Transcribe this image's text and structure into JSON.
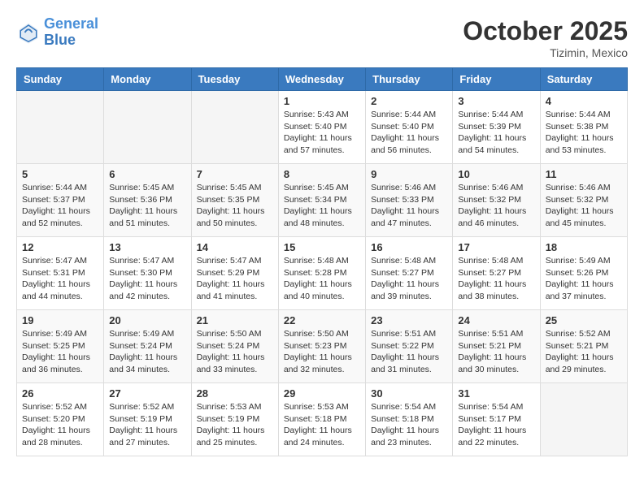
{
  "header": {
    "logo_line1": "General",
    "logo_line2": "Blue",
    "month": "October 2025",
    "location": "Tizimin, Mexico"
  },
  "weekdays": [
    "Sunday",
    "Monday",
    "Tuesday",
    "Wednesday",
    "Thursday",
    "Friday",
    "Saturday"
  ],
  "weeks": [
    [
      {
        "day": "",
        "info": ""
      },
      {
        "day": "",
        "info": ""
      },
      {
        "day": "",
        "info": ""
      },
      {
        "day": "1",
        "info": "Sunrise: 5:43 AM\nSunset: 5:40 PM\nDaylight: 11 hours\nand 57 minutes."
      },
      {
        "day": "2",
        "info": "Sunrise: 5:44 AM\nSunset: 5:40 PM\nDaylight: 11 hours\nand 56 minutes."
      },
      {
        "day": "3",
        "info": "Sunrise: 5:44 AM\nSunset: 5:39 PM\nDaylight: 11 hours\nand 54 minutes."
      },
      {
        "day": "4",
        "info": "Sunrise: 5:44 AM\nSunset: 5:38 PM\nDaylight: 11 hours\nand 53 minutes."
      }
    ],
    [
      {
        "day": "5",
        "info": "Sunrise: 5:44 AM\nSunset: 5:37 PM\nDaylight: 11 hours\nand 52 minutes."
      },
      {
        "day": "6",
        "info": "Sunrise: 5:45 AM\nSunset: 5:36 PM\nDaylight: 11 hours\nand 51 minutes."
      },
      {
        "day": "7",
        "info": "Sunrise: 5:45 AM\nSunset: 5:35 PM\nDaylight: 11 hours\nand 50 minutes."
      },
      {
        "day": "8",
        "info": "Sunrise: 5:45 AM\nSunset: 5:34 PM\nDaylight: 11 hours\nand 48 minutes."
      },
      {
        "day": "9",
        "info": "Sunrise: 5:46 AM\nSunset: 5:33 PM\nDaylight: 11 hours\nand 47 minutes."
      },
      {
        "day": "10",
        "info": "Sunrise: 5:46 AM\nSunset: 5:32 PM\nDaylight: 11 hours\nand 46 minutes."
      },
      {
        "day": "11",
        "info": "Sunrise: 5:46 AM\nSunset: 5:32 PM\nDaylight: 11 hours\nand 45 minutes."
      }
    ],
    [
      {
        "day": "12",
        "info": "Sunrise: 5:47 AM\nSunset: 5:31 PM\nDaylight: 11 hours\nand 44 minutes."
      },
      {
        "day": "13",
        "info": "Sunrise: 5:47 AM\nSunset: 5:30 PM\nDaylight: 11 hours\nand 42 minutes."
      },
      {
        "day": "14",
        "info": "Sunrise: 5:47 AM\nSunset: 5:29 PM\nDaylight: 11 hours\nand 41 minutes."
      },
      {
        "day": "15",
        "info": "Sunrise: 5:48 AM\nSunset: 5:28 PM\nDaylight: 11 hours\nand 40 minutes."
      },
      {
        "day": "16",
        "info": "Sunrise: 5:48 AM\nSunset: 5:27 PM\nDaylight: 11 hours\nand 39 minutes."
      },
      {
        "day": "17",
        "info": "Sunrise: 5:48 AM\nSunset: 5:27 PM\nDaylight: 11 hours\nand 38 minutes."
      },
      {
        "day": "18",
        "info": "Sunrise: 5:49 AM\nSunset: 5:26 PM\nDaylight: 11 hours\nand 37 minutes."
      }
    ],
    [
      {
        "day": "19",
        "info": "Sunrise: 5:49 AM\nSunset: 5:25 PM\nDaylight: 11 hours\nand 36 minutes."
      },
      {
        "day": "20",
        "info": "Sunrise: 5:49 AM\nSunset: 5:24 PM\nDaylight: 11 hours\nand 34 minutes."
      },
      {
        "day": "21",
        "info": "Sunrise: 5:50 AM\nSunset: 5:24 PM\nDaylight: 11 hours\nand 33 minutes."
      },
      {
        "day": "22",
        "info": "Sunrise: 5:50 AM\nSunset: 5:23 PM\nDaylight: 11 hours\nand 32 minutes."
      },
      {
        "day": "23",
        "info": "Sunrise: 5:51 AM\nSunset: 5:22 PM\nDaylight: 11 hours\nand 31 minutes."
      },
      {
        "day": "24",
        "info": "Sunrise: 5:51 AM\nSunset: 5:21 PM\nDaylight: 11 hours\nand 30 minutes."
      },
      {
        "day": "25",
        "info": "Sunrise: 5:52 AM\nSunset: 5:21 PM\nDaylight: 11 hours\nand 29 minutes."
      }
    ],
    [
      {
        "day": "26",
        "info": "Sunrise: 5:52 AM\nSunset: 5:20 PM\nDaylight: 11 hours\nand 28 minutes."
      },
      {
        "day": "27",
        "info": "Sunrise: 5:52 AM\nSunset: 5:19 PM\nDaylight: 11 hours\nand 27 minutes."
      },
      {
        "day": "28",
        "info": "Sunrise: 5:53 AM\nSunset: 5:19 PM\nDaylight: 11 hours\nand 25 minutes."
      },
      {
        "day": "29",
        "info": "Sunrise: 5:53 AM\nSunset: 5:18 PM\nDaylight: 11 hours\nand 24 minutes."
      },
      {
        "day": "30",
        "info": "Sunrise: 5:54 AM\nSunset: 5:18 PM\nDaylight: 11 hours\nand 23 minutes."
      },
      {
        "day": "31",
        "info": "Sunrise: 5:54 AM\nSunset: 5:17 PM\nDaylight: 11 hours\nand 22 minutes."
      },
      {
        "day": "",
        "info": ""
      }
    ]
  ]
}
